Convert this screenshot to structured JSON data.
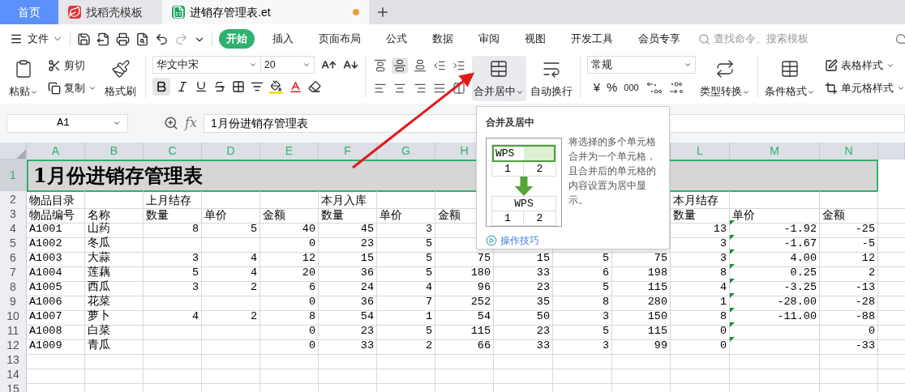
{
  "tabs": [
    {
      "label": "首页",
      "kind": "home",
      "selected": false,
      "modified": false
    },
    {
      "label": "找稻壳模板",
      "kind": "docer",
      "selected": false,
      "modified": false
    },
    {
      "label": "进销存管理表.et",
      "kind": "sheet",
      "selected": true,
      "modified": true
    }
  ],
  "menu": {
    "file": "文件",
    "ribbon_tabs": [
      {
        "label": "开始",
        "selected": true
      },
      {
        "label": "插入",
        "selected": false
      },
      {
        "label": "页面布局",
        "selected": false
      },
      {
        "label": "公式",
        "selected": false
      },
      {
        "label": "数据",
        "selected": false
      },
      {
        "label": "审阅",
        "selected": false
      },
      {
        "label": "视图",
        "selected": false
      },
      {
        "label": "开发工具",
        "selected": false
      },
      {
        "label": "会员专享",
        "selected": false
      }
    ],
    "search_placeholder": "查找命令、搜索模板"
  },
  "ribbon": {
    "paste": "粘贴",
    "cut": "剪切",
    "copy": "复制",
    "format_painter": "格式刷",
    "font_name": "华文中宋",
    "font_size": "20",
    "bold": true,
    "align_buttons": [
      {
        "kind": "top",
        "selected": false
      },
      {
        "kind": "middle",
        "selected": true
      },
      {
        "kind": "bottom",
        "selected": false
      },
      {
        "kind": "outdent",
        "selected": false
      },
      {
        "kind": "indent",
        "selected": false
      },
      {
        "kind": "left",
        "selected": false
      },
      {
        "kind": "center",
        "selected": false
      },
      {
        "kind": "right",
        "selected": false
      },
      {
        "kind": "justify",
        "selected": false
      },
      {
        "kind": "distributed",
        "selected": false
      }
    ],
    "merge": {
      "label": "合并居中",
      "highlighted": true
    },
    "wrap": "自动换行",
    "number_format": "常规",
    "currency": "¥",
    "percent": "%",
    "thousands": "000",
    "convert": "类型转换",
    "conditional": "条件格式",
    "table_style": "表格样式",
    "cell_style": "单元格样式"
  },
  "formula_bar": {
    "cell": "A1",
    "fx": "fx",
    "value": "1月份进销存管理表"
  },
  "sheet": {
    "columns": [
      {
        "label": "A",
        "selected": true
      },
      {
        "label": "B",
        "selected": true
      },
      {
        "label": "C",
        "selected": true
      },
      {
        "label": "D",
        "selected": true
      },
      {
        "label": "E",
        "selected": true
      },
      {
        "label": "F",
        "selected": true
      },
      {
        "label": "G",
        "selected": true
      },
      {
        "label": "H",
        "selected": true
      },
      {
        "label": "L",
        "selected": true
      },
      {
        "label": "M",
        "selected": true
      },
      {
        "label": "N",
        "selected": true
      }
    ],
    "title": {
      "row": "1",
      "text": "1月份进销存管理表",
      "selected": true
    },
    "rows": [
      {
        "number": "2",
        "kind": "header",
        "flagged": false,
        "cells": [
          "物品目录",
          null,
          "上月结存",
          null,
          null,
          "本月入库",
          null,
          null,
          null,
          null,
          null,
          "本月结存",
          null,
          null
        ]
      },
      {
        "number": "3",
        "kind": "header",
        "flagged": false,
        "cells": [
          "物品编号",
          "名称",
          "数量",
          "单价",
          "金额",
          "数量",
          "单价",
          "金额",
          null,
          null,
          null,
          "数量",
          "单价",
          "金额"
        ]
      },
      {
        "number": "4",
        "kind": "data",
        "flagged": true,
        "cells": [
          "A1001",
          "山药",
          "8",
          "5",
          "40",
          "45",
          "3",
          null,
          null,
          null,
          null,
          "13",
          "-1.92",
          "-25"
        ]
      },
      {
        "number": "5",
        "kind": "data",
        "flagged": true,
        "cells": [
          "A1002",
          "冬瓜",
          null,
          null,
          "0",
          "23",
          "5",
          null,
          null,
          null,
          null,
          "3",
          "-1.67",
          "-5"
        ]
      },
      {
        "number": "6",
        "kind": "data",
        "flagged": true,
        "cells": [
          "A1003",
          "大蒜",
          "3",
          "4",
          "12",
          "15",
          "5",
          "75",
          "15",
          "5",
          "75",
          "3",
          "4.00",
          "12"
        ]
      },
      {
        "number": "7",
        "kind": "data",
        "flagged": true,
        "cells": [
          "A1004",
          "莲藕",
          "5",
          "4",
          "20",
          "36",
          "5",
          "180",
          "33",
          "6",
          "198",
          "8",
          "0.25",
          "2"
        ]
      },
      {
        "number": "8",
        "kind": "data",
        "flagged": true,
        "cells": [
          "A1005",
          "西瓜",
          "3",
          "2",
          "6",
          "24",
          "4",
          "96",
          "23",
          "5",
          "115",
          "4",
          "-3.25",
          "-13"
        ]
      },
      {
        "number": "9",
        "kind": "data",
        "flagged": true,
        "cells": [
          "A1006",
          "花菜",
          null,
          null,
          "0",
          "36",
          "7",
          "252",
          "35",
          "8",
          "280",
          "1",
          "-28.00",
          "-28"
        ]
      },
      {
        "number": "10",
        "kind": "data",
        "flagged": true,
        "cells": [
          "A1007",
          "萝卜",
          "4",
          "2",
          "8",
          "54",
          "1",
          "54",
          "50",
          "3",
          "150",
          "8",
          "-11.00",
          "-88"
        ]
      },
      {
        "number": "11",
        "kind": "data",
        "flagged": true,
        "cells": [
          "A1008",
          "白菜",
          null,
          null,
          "0",
          "23",
          "5",
          "115",
          "23",
          "5",
          "115",
          "0",
          null,
          "0"
        ]
      },
      {
        "number": "12",
        "kind": "data",
        "flagged": true,
        "cells": [
          "A1009",
          "青瓜",
          null,
          null,
          "0",
          "33",
          "2",
          "66",
          "33",
          "3",
          "99",
          "0",
          null,
          "-33"
        ]
      },
      {
        "number": "13",
        "kind": "data",
        "flagged": false,
        "cells": []
      },
      {
        "number": "14",
        "kind": "data",
        "flagged": false,
        "cells": []
      },
      {
        "number": "15",
        "kind": "data",
        "flagged": false,
        "cells": []
      }
    ]
  },
  "tooltip": {
    "title": "合并及居中",
    "description": "将选择的多个单元格合并为一个单元格，且合并后的单元格的内容设置为居中显示。",
    "example_before": [
      "WPS",
      "1",
      "2"
    ],
    "example_after": [
      "WPS",
      "1",
      "2"
    ],
    "link": "操作技巧"
  }
}
